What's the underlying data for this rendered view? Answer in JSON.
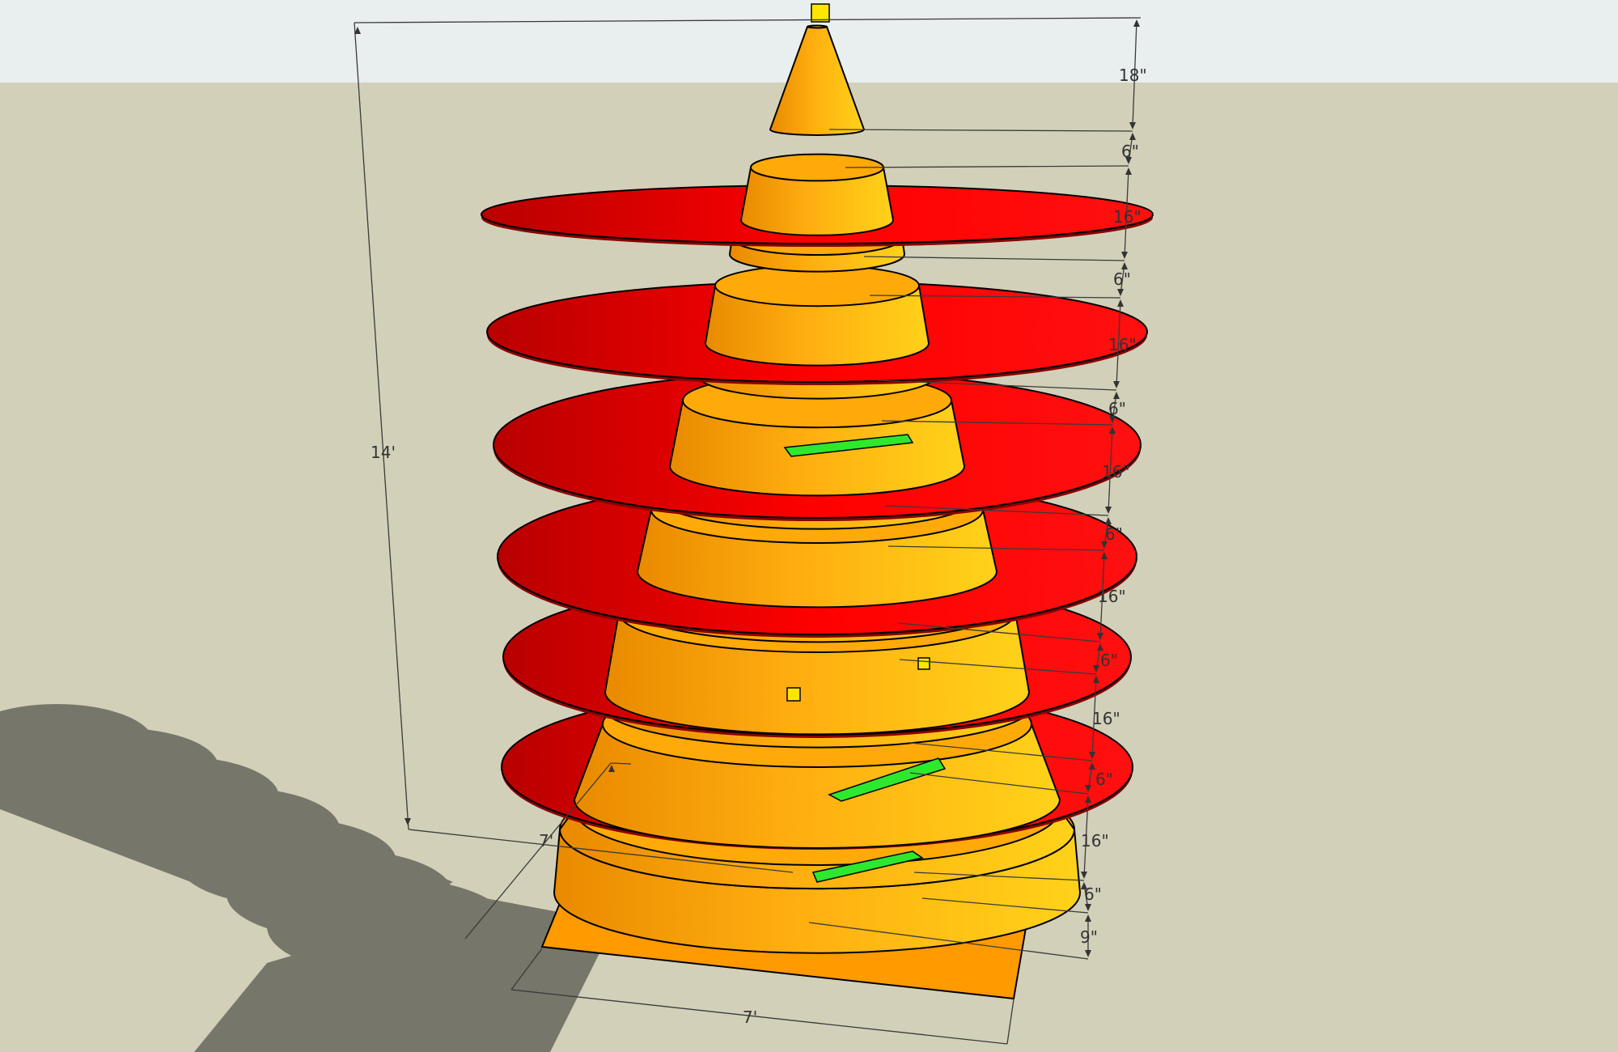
{
  "colors": {
    "sky": "#e9eeee",
    "ground": "#d3d0b9",
    "shadow": "#77766a",
    "base_slab": "#ff9a00",
    "cone_body": "#ffad0d",
    "disc": "#ff0000",
    "green_part": "#2de82d",
    "yellow_block": "#ffe600"
  },
  "dimensions": {
    "overall_height": "14'",
    "base_depth": "7'",
    "base_width": "7'",
    "stack": [
      "18\"",
      "6\"",
      "16\"",
      "6\"",
      "16\"",
      "6\"",
      "16\"",
      "6\"",
      "16\"",
      "6\"",
      "16\"",
      "6\"",
      "16\"",
      "6\"",
      "9\""
    ]
  }
}
